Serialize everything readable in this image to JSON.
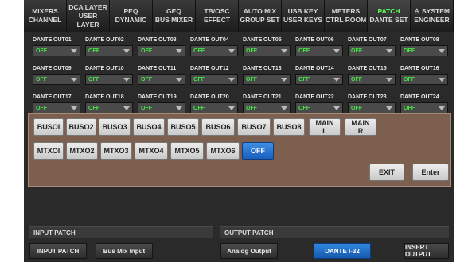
{
  "tabs": [
    {
      "line1": "MIXERS",
      "line2": "CHANNEL",
      "active": false
    },
    {
      "line1": "DCA LAYER",
      "line2": "USER LAYER",
      "active": false
    },
    {
      "line1": "PEQ",
      "line2": "DYNAMIC",
      "active": false
    },
    {
      "line1": "GEQ",
      "line2": "BUS MIXER",
      "active": false
    },
    {
      "line1": "TB/OSC",
      "line2": "EFFECT",
      "active": false
    },
    {
      "line1": "AUTO MIX",
      "line2": "GROUP SET",
      "active": false
    },
    {
      "line1": "USB KEY",
      "line2": "USER KEYS",
      "active": false
    },
    {
      "line1": "METERS",
      "line2": "CTRL ROOM",
      "active": false
    },
    {
      "line1": "PATCH",
      "line2": "DANTE SET",
      "active": true
    },
    {
      "line1": "♙ SYSTEM",
      "line2": "ENGINEER",
      "active": false
    }
  ],
  "dante_outputs": [
    [
      {
        "label": "DANTE OUT01",
        "value": "OFF"
      },
      {
        "label": "DANTE OUT02",
        "value": "OFF"
      },
      {
        "label": "DANTE OUT03",
        "value": "OFF"
      },
      {
        "label": "DANTE OUT04",
        "value": "OFF"
      },
      {
        "label": "DANTE OUT05",
        "value": "OFF"
      },
      {
        "label": "DANTE OUT06",
        "value": "OFF"
      },
      {
        "label": "DANTE OUT07",
        "value": "OFF"
      },
      {
        "label": "DANTE OUT08",
        "value": "OFF"
      }
    ],
    [
      {
        "label": "DANTE OUT09",
        "value": "OFF"
      },
      {
        "label": "DANTE OUT10",
        "value": "OFF"
      },
      {
        "label": "DANTE OUT11",
        "value": "OFF"
      },
      {
        "label": "DANTE OUT12",
        "value": "OFF"
      },
      {
        "label": "DANTE OUT13",
        "value": "OFF"
      },
      {
        "label": "DANTE OUT14",
        "value": "OFF"
      },
      {
        "label": "DANTE OUT15",
        "value": "OFF"
      },
      {
        "label": "DANTE OUT16",
        "value": "OFF"
      }
    ],
    [
      {
        "label": "DANTE OUT17",
        "value": "OFF"
      },
      {
        "label": "DANTE OUT18",
        "value": "OFF"
      },
      {
        "label": "DANTE OUT19",
        "value": "OFF"
      },
      {
        "label": "DANTE OUT20",
        "value": "OFF"
      },
      {
        "label": "DANTE OUT21",
        "value": "OFF"
      },
      {
        "label": "DANTE OUT22",
        "value": "OFF"
      },
      {
        "label": "DANTE OUT23",
        "value": "OFF"
      },
      {
        "label": "DANTE OUT24",
        "value": "OFF"
      }
    ]
  ],
  "popup": {
    "bus_buttons": [
      "BUSOl",
      "BUSO2",
      "BUSO3",
      "BUSO4",
      "BUSO5",
      "BUSO6",
      "BUSO7",
      "BUSO8"
    ],
    "main_buttons": [
      {
        "line1": "MAIN",
        "line2": "L"
      },
      {
        "line1": "MAIN",
        "line2": "R"
      }
    ],
    "mtx_buttons": [
      "MTXOl",
      "MTXO2",
      "MTXO3",
      "MTXO4",
      "MTXO5",
      "MTXO6"
    ],
    "off_label": "OFF",
    "exit_label": "EXIT",
    "enter_label": "Enter"
  },
  "input_patch": {
    "header": "INPUT PATCH",
    "buttons": [
      "INPUT PATCH",
      "Bus Mix Input"
    ]
  },
  "output_patch": {
    "header": "OUTPUT PATCH",
    "buttons": [
      "Analog Output",
      "DANTE I-32",
      "INSERT OUTPUT"
    ]
  },
  "colors": {
    "active_tab_text": "#5cff5c",
    "off_value": "#44e844",
    "selected_button": "#2f86df",
    "popup_bg": "#7d5f4f"
  }
}
